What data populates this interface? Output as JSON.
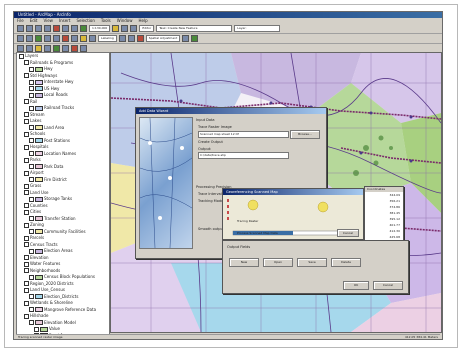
{
  "window": {
    "title": "Untitled - ArcMap - ArcInfo"
  },
  "menu": [
    "File",
    "Edit",
    "View",
    "Insert",
    "Selection",
    "Tools",
    "Window",
    "Help"
  ],
  "toolbar": {
    "scale": "1:130,000",
    "editor": "Editor",
    "target": "Task: Create New Feature",
    "layer_select": "Layer:",
    "labeling": "Labeling",
    "spatial_adjust": "Spatial Adjustment"
  },
  "toc": {
    "items": [
      {
        "label": "Layers",
        "indent": 0
      },
      {
        "label": "Railroads & Programs",
        "indent": 1
      },
      {
        "label": "Hwy",
        "indent": 2
      },
      {
        "label": "Std Highways",
        "indent": 1
      },
      {
        "label": "Interstate Hwy",
        "indent": 2
      },
      {
        "label": "US Hwy",
        "indent": 2
      },
      {
        "label": "Local Roads",
        "indent": 2
      },
      {
        "label": "Rail",
        "indent": 1
      },
      {
        "label": "Railroad Tracks",
        "indent": 2
      },
      {
        "label": "Stream",
        "indent": 1
      },
      {
        "label": "Lakes",
        "indent": 1
      },
      {
        "label": "Land Area",
        "indent": 2
      },
      {
        "label": "Schools",
        "indent": 1
      },
      {
        "label": "Post Stations",
        "indent": 2
      },
      {
        "label": "Hospitals",
        "indent": 1
      },
      {
        "label": "Location Names",
        "indent": 2
      },
      {
        "label": "Parks",
        "indent": 1
      },
      {
        "label": "Park Data",
        "indent": 2
      },
      {
        "label": "Airport",
        "indent": 1
      },
      {
        "label": "Fire District",
        "indent": 2
      },
      {
        "label": "Grass",
        "indent": 1
      },
      {
        "label": "Land Use",
        "indent": 1
      },
      {
        "label": "Storage Tanks",
        "indent": 2
      },
      {
        "label": "Counties",
        "indent": 1
      },
      {
        "label": "Cities",
        "indent": 1
      },
      {
        "label": "Transfer Station",
        "indent": 2
      },
      {
        "label": "Zoning",
        "indent": 1
      },
      {
        "label": "Community Facilities",
        "indent": 2
      },
      {
        "label": "Parcels",
        "indent": 1
      },
      {
        "label": "Census Tracts",
        "indent": 1
      },
      {
        "label": "Election Areas",
        "indent": 2
      },
      {
        "label": "Elevation",
        "indent": 1
      },
      {
        "label": "Water Features",
        "indent": 1
      },
      {
        "label": "Neighborhoods",
        "indent": 1
      },
      {
        "label": "Census Block Populations",
        "indent": 2
      },
      {
        "label": "Region_2020 Districts",
        "indent": 1
      },
      {
        "label": "Land Use_Census",
        "indent": 1
      },
      {
        "label": "Election_Districts",
        "indent": 2
      },
      {
        "label": "Wetlands & Shoreline",
        "indent": 1
      },
      {
        "label": "Mangrove Reference Data",
        "indent": 2
      },
      {
        "label": "Hillshade",
        "indent": 1
      },
      {
        "label": "Elevation Model",
        "indent": 2
      },
      {
        "label": "Value",
        "indent": 3
      },
      {
        "label": "Band 1",
        "indent": 3
      },
      {
        "label": "Band 2",
        "indent": 3
      },
      {
        "label": "Band 3",
        "indent": 3
      },
      {
        "label": "Band 4",
        "indent": 3
      },
      {
        "label": "Band 5",
        "indent": 3
      }
    ]
  },
  "dialog_main": {
    "title": "Add Data Wizard",
    "section_input": "Input Data",
    "opt_trace": "Trace Raster Image",
    "opt_trace_value": "Scanned map sheet 12.tif",
    "browse": "Browse...",
    "opt_trace2": "Create Output",
    "section_freq": "Processing Precision",
    "freq_a": "Trace Interval",
    "freq_b": "Tracking Mode",
    "check_label": "Smooth output line",
    "output_label": "Output:",
    "output_value": "C:\\data\\trace.shp",
    "section_output": "Output Fields"
  },
  "dialog_progress": {
    "title": "Georeferencing Scanned Map",
    "label1": "Tracing Raster",
    "label2": "Process Scanned Map Data",
    "cancel": "Cancel",
    "list_header": "Coordinates",
    "list_values": [
      "344.09",
      "356.21",
      "374.86",
      "381.45",
      "395.12",
      "401.77",
      "412.30",
      "425.68",
      "433.91"
    ],
    "add": "Add Point"
  },
  "dialog_bottom": {
    "title": "Output Fields",
    "btn_new": "New",
    "btn_open": "Open",
    "btn_save": "Save",
    "btn_delete": "Delete",
    "ok": "OK",
    "cancel": "Cancel",
    "help": "Help"
  },
  "status": {
    "left": "Tracing scanned raster image",
    "right": "412.05  384.41 Meters"
  }
}
